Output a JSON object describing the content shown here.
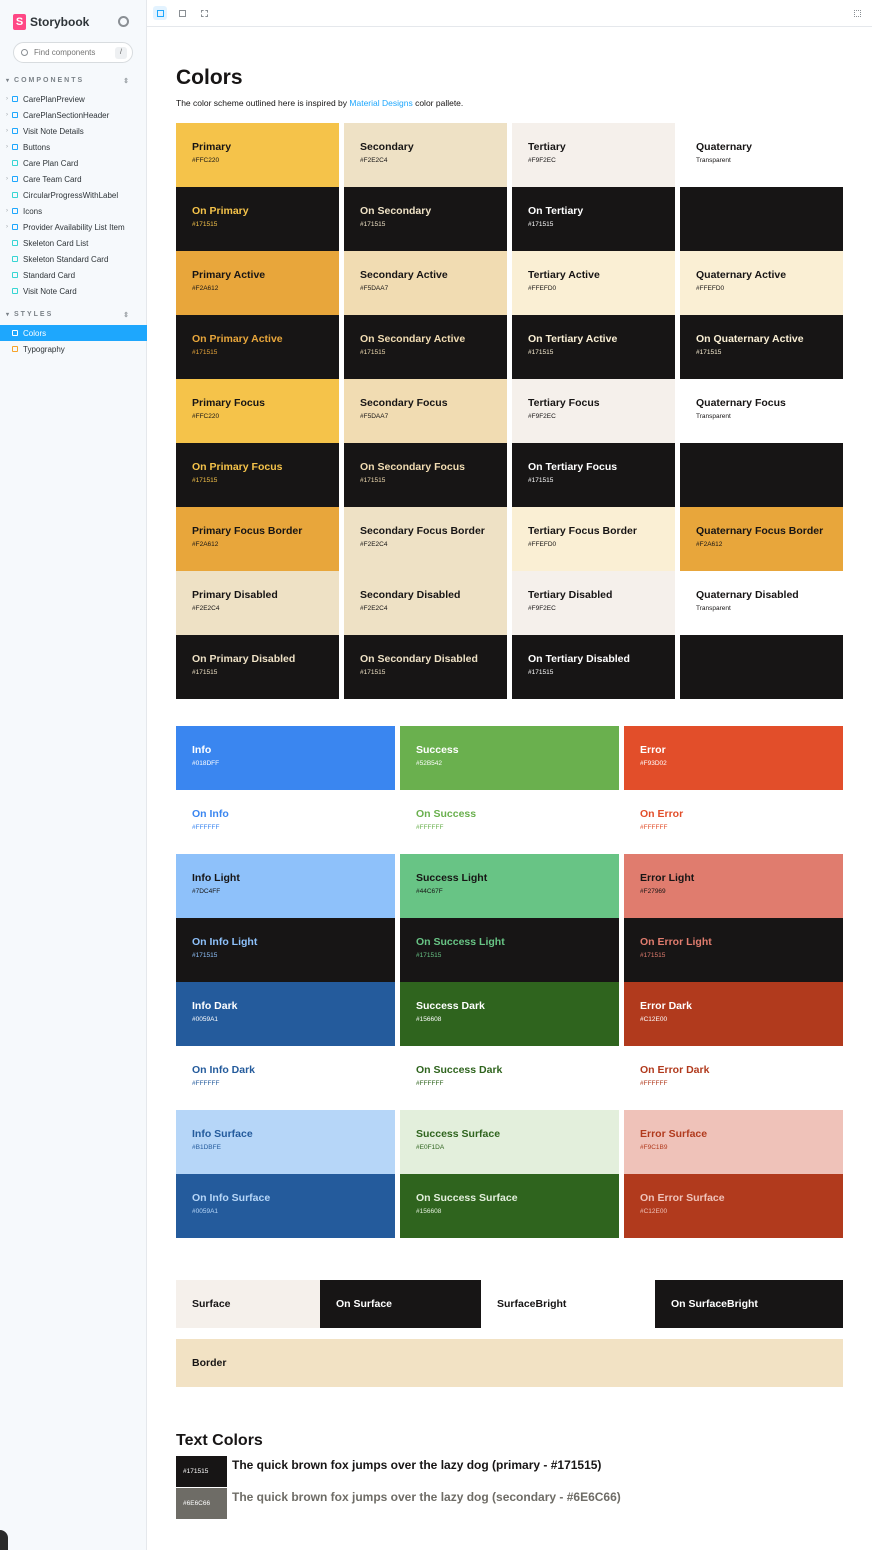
{
  "sidebar": {
    "brand": "Storybook",
    "search_placeholder": "Find components",
    "search_shortcut": "/",
    "components_header": "COMPONENTS",
    "styles_header": "STYLES",
    "components": [
      {
        "label": "CarePlanPreview",
        "type": "folder"
      },
      {
        "label": "CarePlanSectionHeader",
        "type": "component"
      },
      {
        "label": "Visit Note Details",
        "type": "component"
      },
      {
        "label": "Buttons",
        "type": "component"
      },
      {
        "label": "Care Plan Card",
        "type": "story"
      },
      {
        "label": "Care Team Card",
        "type": "component"
      },
      {
        "label": "CircularProgressWithLabel",
        "type": "story"
      },
      {
        "label": "Icons",
        "type": "component"
      },
      {
        "label": "Provider Availability List Item",
        "type": "component"
      },
      {
        "label": "Skeleton Card List",
        "type": "story"
      },
      {
        "label": "Skeleton Standard Card",
        "type": "story"
      },
      {
        "label": "Standard Card",
        "type": "story"
      },
      {
        "label": "Visit Note Card",
        "type": "story"
      }
    ],
    "styles": [
      {
        "label": "Colors",
        "active": true
      },
      {
        "label": "Typography",
        "active": false
      }
    ]
  },
  "page": {
    "title": "Colors",
    "intro_before": "The color scheme outlined here is inspired by ",
    "intro_link": "Material Designs",
    "intro_after": " color pallete."
  },
  "brand_swatches": [
    {
      "name": "Primary",
      "hex": "#FFC220",
      "bg": "#F5C34A",
      "fg": "#171515"
    },
    {
      "name": "Secondary",
      "hex": "#F2E2C4",
      "bg": "#EEE1C5",
      "fg": "#171515"
    },
    {
      "name": "Tertiary",
      "hex": "#F9F2EC",
      "bg": "#F5F0EB",
      "fg": "#171515"
    },
    {
      "name": "Quaternary",
      "hex": "Transparent",
      "bg": "#FFFFFF",
      "fg": "#171515"
    },
    {
      "name": "On Primary",
      "hex": "#171515",
      "bg": "#171515",
      "fg": "#F5C34A"
    },
    {
      "name": "On Secondary",
      "hex": "#171515",
      "bg": "#171515",
      "fg": "#EEE1C5"
    },
    {
      "name": "On Tertiary",
      "hex": "#171515",
      "bg": "#171515",
      "fg": "#FFFFFF"
    },
    {
      "name": "",
      "hex": "",
      "bg": "#171515",
      "fg": "#171515"
    },
    {
      "name": "Primary Active",
      "hex": "#F2A612",
      "bg": "#E8A63B",
      "fg": "#171515"
    },
    {
      "name": "Secondary Active",
      "hex": "#F5DAA7",
      "bg": "#F1DCB2",
      "fg": "#171515"
    },
    {
      "name": "Tertiary Active",
      "hex": "#FFEFD0",
      "bg": "#FAEFD4",
      "fg": "#171515"
    },
    {
      "name": "Quaternary Active",
      "hex": "#FFEFD0",
      "bg": "#FAEFD4",
      "fg": "#171515"
    },
    {
      "name": "On Primary Active",
      "hex": "#171515",
      "bg": "#171515",
      "fg": "#E8A63B"
    },
    {
      "name": "On Secondary Active",
      "hex": "#171515",
      "bg": "#171515",
      "fg": "#F1DCB2"
    },
    {
      "name": "On Tertiary Active",
      "hex": "#171515",
      "bg": "#171515",
      "fg": "#FAEFD4"
    },
    {
      "name": "On Quaternary Active",
      "hex": "#171515",
      "bg": "#171515",
      "fg": "#FAEFD4"
    },
    {
      "name": "Primary Focus",
      "hex": "#FFC220",
      "bg": "#F5C34A",
      "fg": "#171515"
    },
    {
      "name": "Secondary Focus",
      "hex": "#F5DAA7",
      "bg": "#F1DCB2",
      "fg": "#171515"
    },
    {
      "name": "Tertiary Focus",
      "hex": "#F9F2EC",
      "bg": "#F5F0EB",
      "fg": "#171515"
    },
    {
      "name": "Quaternary Focus",
      "hex": "Transparent",
      "bg": "#FFFFFF",
      "fg": "#171515"
    },
    {
      "name": "On Primary Focus",
      "hex": "#171515",
      "bg": "#171515",
      "fg": "#F5C34A"
    },
    {
      "name": "On Secondary Focus",
      "hex": "#171515",
      "bg": "#171515",
      "fg": "#F1DCB2"
    },
    {
      "name": "On Tertiary Focus",
      "hex": "#171515",
      "bg": "#171515",
      "fg": "#FFFFFF"
    },
    {
      "name": "",
      "hex": "",
      "bg": "#171515",
      "fg": "#171515"
    },
    {
      "name": "Primary Focus Border",
      "hex": "#F2A612",
      "bg": "#E8A63B",
      "fg": "#171515"
    },
    {
      "name": "Secondary Focus Border",
      "hex": "#F2E2C4",
      "bg": "#EEE1C5",
      "fg": "#171515"
    },
    {
      "name": "Tertiary Focus Border",
      "hex": "#FFEFD0",
      "bg": "#FAEFD4",
      "fg": "#171515"
    },
    {
      "name": "Quaternary Focus Border",
      "hex": "#F2A612",
      "bg": "#E8A63B",
      "fg": "#171515"
    },
    {
      "name": "Primary Disabled",
      "hex": "#F2E2C4",
      "bg": "#EEE1C5",
      "fg": "#171515"
    },
    {
      "name": "Secondary Disabled",
      "hex": "#F2E2C4",
      "bg": "#EEE1C5",
      "fg": "#171515"
    },
    {
      "name": "Tertiary Disabled",
      "hex": "#F9F2EC",
      "bg": "#F5F0EB",
      "fg": "#171515"
    },
    {
      "name": "Quaternary Disabled",
      "hex": "Transparent",
      "bg": "#FFFFFF",
      "fg": "#171515"
    },
    {
      "name": "On Primary Disabled",
      "hex": "#171515",
      "bg": "#171515",
      "fg": "#EEE1C5"
    },
    {
      "name": "On Secondary Disabled",
      "hex": "#171515",
      "bg": "#171515",
      "fg": "#EEE1C5"
    },
    {
      "name": "On Tertiary Disabled",
      "hex": "#171515",
      "bg": "#171515",
      "fg": "#FFFFFF"
    },
    {
      "name": "",
      "hex": "",
      "bg": "#171515",
      "fg": "#171515"
    }
  ],
  "status_swatches": [
    {
      "name": "Info",
      "hex": "#018DFF",
      "bg": "#3A86F0",
      "fg": "#FFFFFF"
    },
    {
      "name": "Success",
      "hex": "#52B542",
      "bg": "#6AB04E",
      "fg": "#FFFFFF"
    },
    {
      "name": "Error",
      "hex": "#F93D02",
      "bg": "#E24E2A",
      "fg": "#FFFFFF"
    },
    {
      "name": "On Info",
      "hex": "#FFFFFF",
      "bg": "#FFFFFF",
      "fg": "#3A86F0"
    },
    {
      "name": "On Success",
      "hex": "#FFFFFF",
      "bg": "#FFFFFF",
      "fg": "#6AB04E"
    },
    {
      "name": "On Error",
      "hex": "#FFFFFF",
      "bg": "#FFFFFF",
      "fg": "#E24E2A"
    },
    {
      "name": "Info Light",
      "hex": "#7DC4FF",
      "bg": "#8EC1FA",
      "fg": "#171515"
    },
    {
      "name": "Success Light",
      "hex": "#44C67F",
      "bg": "#68C485",
      "fg": "#171515"
    },
    {
      "name": "Error Light",
      "hex": "#F27969",
      "bg": "#E07C6E",
      "fg": "#171515"
    },
    {
      "name": "On Info Light",
      "hex": "#171515",
      "bg": "#171515",
      "fg": "#8EC1FA"
    },
    {
      "name": "On Success Light",
      "hex": "#171515",
      "bg": "#171515",
      "fg": "#68C485"
    },
    {
      "name": "On Error Light",
      "hex": "#171515",
      "bg": "#171515",
      "fg": "#E07C6E"
    },
    {
      "name": "Info Dark",
      "hex": "#0059A1",
      "bg": "#245B9C",
      "fg": "#FFFFFF"
    },
    {
      "name": "Success Dark",
      "hex": "#156608",
      "bg": "#2F641E",
      "fg": "#FFFFFF"
    },
    {
      "name": "Error Dark",
      "hex": "#C12E00",
      "bg": "#B13A1D",
      "fg": "#FFFFFF"
    },
    {
      "name": "On Info Dark",
      "hex": "#FFFFFF",
      "bg": "#FFFFFF",
      "fg": "#245B9C"
    },
    {
      "name": "On Success Dark",
      "hex": "#FFFFFF",
      "bg": "#FFFFFF",
      "fg": "#2F641E"
    },
    {
      "name": "On Error Dark",
      "hex": "#FFFFFF",
      "bg": "#FFFFFF",
      "fg": "#B13A1D"
    },
    {
      "name": "Info Surface",
      "hex": "#B1DBFE",
      "bg": "#B6D6F8",
      "fg": "#245B9C"
    },
    {
      "name": "Success Surface",
      "hex": "#E0F1DA",
      "bg": "#E3EFDC",
      "fg": "#2F641E"
    },
    {
      "name": "Error Surface",
      "hex": "#F9C1B9",
      "bg": "#EFC2B9",
      "fg": "#B13A1D"
    },
    {
      "name": "On Info Surface",
      "hex": "#0059A1",
      "bg": "#245B9C",
      "fg": "#B6D6F8"
    },
    {
      "name": "On Success Surface",
      "hex": "#156608",
      "bg": "#2F641E",
      "fg": "#E3EFDC"
    },
    {
      "name": "On Error Surface",
      "hex": "#C12E00",
      "bg": "#B13A1D",
      "fg": "#EFC2B9"
    }
  ],
  "surfaces": [
    {
      "name": "Surface",
      "bg": "#F5F0EB",
      "fg": "#171515"
    },
    {
      "name": "On Surface",
      "bg": "#171515",
      "fg": "#FFFFFF"
    },
    {
      "name": "SurfaceBright",
      "bg": "#FFFFFF",
      "fg": "#171515"
    },
    {
      "name": "On SurfaceBright",
      "bg": "#171515",
      "fg": "#FFFFFF"
    }
  ],
  "border": {
    "name": "Border"
  },
  "text_colors": {
    "title": "Text Colors",
    "primary": {
      "chip": "#171515",
      "sample": "The quick brown fox jumps over the lazy dog (primary - #171515)",
      "color": "#171515"
    },
    "secondary": {
      "chip": "#6E6C66",
      "sample": "The quick brown fox jumps over the lazy dog (secondary - #6E6C66)",
      "color": "#6E6C66"
    }
  }
}
